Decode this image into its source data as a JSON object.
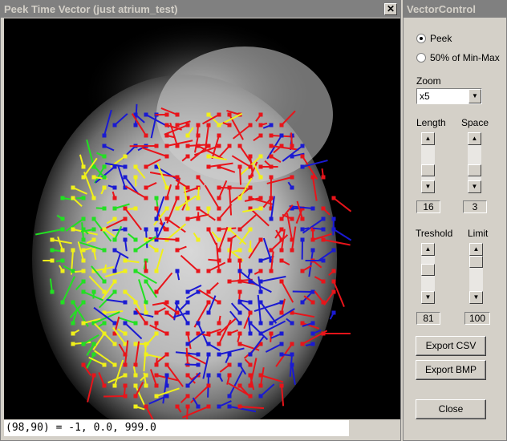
{
  "image_window": {
    "title": "Peek Time Vector (just atrium_test)",
    "close_glyph": "✕",
    "status": "(98,90) = -1, 0.0, 999.0"
  },
  "vector_control": {
    "title": "VectorControl",
    "radio_peek": "Peek",
    "radio_minmax": "50% of Min-Max",
    "selected_mode": "Peek",
    "zoom_label": "Zoom",
    "zoom_value": "x5",
    "length_label": "Length",
    "length_value": "16",
    "space_label": "Space",
    "space_value": "3",
    "treshold_label": "Treshold",
    "treshold_value": "81",
    "limit_label": "Limit",
    "limit_value": "100",
    "export_csv_label": "Export CSV",
    "export_bmp_label": "Export BMP",
    "close_label": "Close"
  },
  "vector_colors": {
    "red": "#e8141a",
    "blue": "#1a1ad2",
    "green": "#22e022",
    "yellow": "#f0f01a"
  },
  "icons": [
    "close-icon",
    "dropdown-arrow-icon",
    "scroll-up-icon",
    "scroll-down-icon"
  ]
}
